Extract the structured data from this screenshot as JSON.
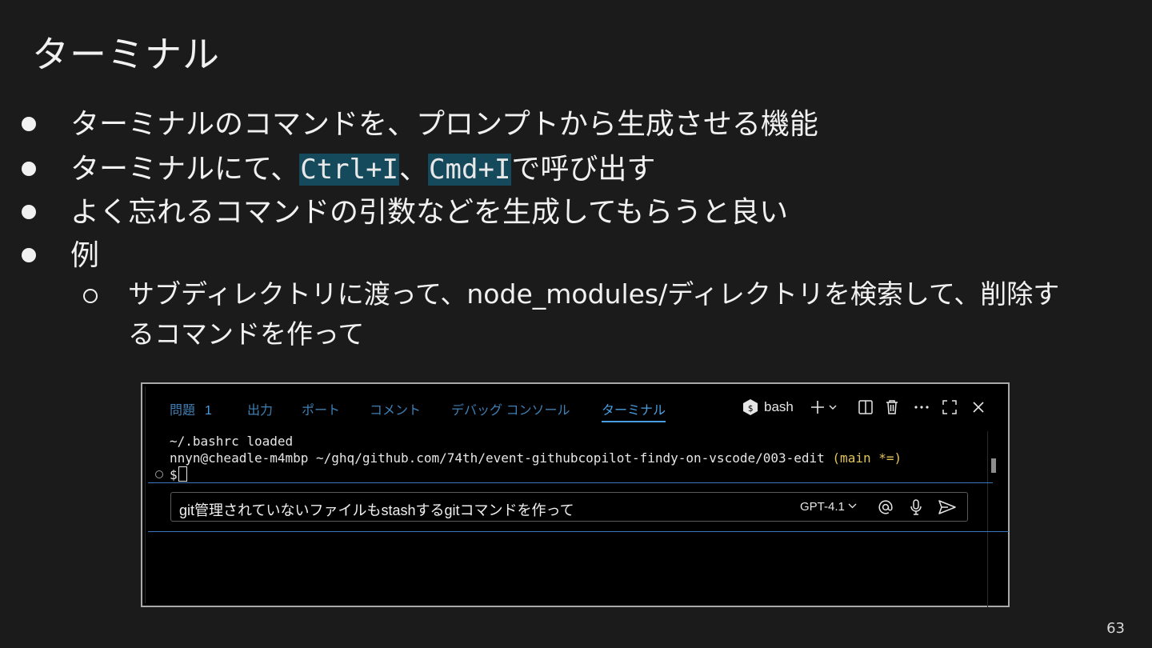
{
  "slide": {
    "title": "ターミナル",
    "page_number": "63",
    "bullets": [
      {
        "text": "ターミナルのコマンドを、プロンプトから生成させる機能"
      },
      {
        "before": "ターミナルにて、",
        "code1": "Ctrl+I",
        "mid": "、",
        "code2": "Cmd+I",
        "after": "で呼び出す"
      },
      {
        "text": "よく忘れるコマンドの引数などを生成してもらうと良い"
      },
      {
        "text": "例"
      }
    ],
    "sub_bullet": {
      "line1": "サブディレクトリに渡って、node_modules/ディレクトリを検索して、削除す",
      "line2": "るコマンドを作って"
    }
  },
  "panel": {
    "tabs": [
      {
        "label": "問題",
        "badge": "1"
      },
      {
        "label": "出力"
      },
      {
        "label": "ポート"
      },
      {
        "label": "コメント"
      },
      {
        "label": "デバッグ コンソール"
      },
      {
        "label": "ターミナル",
        "active": true
      }
    ],
    "shell_label": "bash",
    "icons": [
      "terminal-shell-icon",
      "plus-icon",
      "chevron-down-icon",
      "split-icon",
      "trash-icon",
      "more-icon",
      "maximize-icon",
      "close-icon"
    ]
  },
  "terminal": {
    "line1": "~/.bashrc loaded",
    "line2_prompt": "nnyn@cheadle-m4mbp ~/ghq/github.com/74th/event-githubcopilot-findy-on-vscode/003-edit ",
    "line2_branch": "(main *=)",
    "line3": "$"
  },
  "chat": {
    "input_text": "git管理されていないファイルもstashするgitコマンドを作って",
    "model": "GPT-4.1",
    "colors": {
      "accent": "#3b76c0",
      "branch": "#e2c35b",
      "highlight": "#154a5c"
    }
  }
}
